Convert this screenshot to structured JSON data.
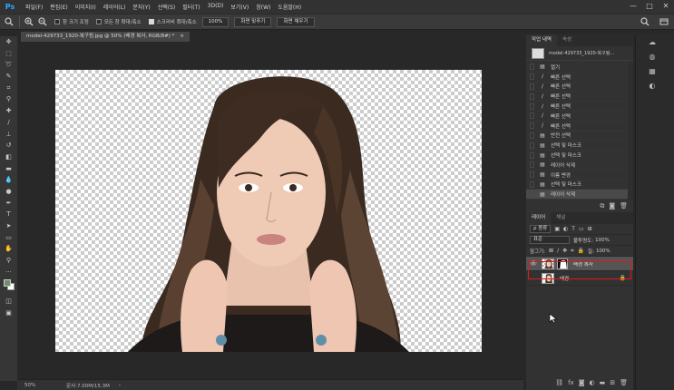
{
  "app": {
    "logo": "Ps"
  },
  "menu": [
    "파일(F)",
    "편집(E)",
    "이미지(I)",
    "레이어(L)",
    "문자(Y)",
    "선택(S)",
    "필터(T)",
    "3D(D)",
    "보기(V)",
    "창(W)",
    "도움말(H)"
  ],
  "window_controls": [
    "—",
    "□",
    "✕"
  ],
  "options": {
    "checks": [
      {
        "label": "창 크기 조정",
        "checked": false
      },
      {
        "label": "모든 창 확대/축소",
        "checked": false
      },
      {
        "label": "스크러비 확대/축소",
        "checked": true
      }
    ],
    "zoom_value": "100%",
    "fit_button": "화면 맞추기",
    "fill_button": "화면 채우기"
  },
  "document": {
    "tab_title": "model-429733_1920-복구됨.jpg @ 50% (배경 복사, RGB/8#) *",
    "tab_close": "×"
  },
  "status": {
    "zoom": "50%",
    "doc_info": "문서:7.00M/15.3M",
    "arrow": "›"
  },
  "history": {
    "tabs": [
      "작업 내역",
      "속성"
    ],
    "snapshot_label": "model-429733_1920-복구됨...",
    "items": [
      {
        "label": "열기",
        "icon": "doc-icon"
      },
      {
        "label": "빠른 선택",
        "icon": "brush-icon"
      },
      {
        "label": "빠른 선택",
        "icon": "brush-icon"
      },
      {
        "label": "빠른 선택",
        "icon": "brush-icon"
      },
      {
        "label": "빠른 선택",
        "icon": "brush-icon"
      },
      {
        "label": "빠른 선택",
        "icon": "brush-icon"
      },
      {
        "label": "빠른 선택",
        "icon": "brush-icon"
      },
      {
        "label": "반전 선택",
        "icon": "doc-icon"
      },
      {
        "label": "선택 및 마스크",
        "icon": "doc-icon"
      },
      {
        "label": "선택 및 마스크",
        "icon": "doc-icon"
      },
      {
        "label": "레이어 삭제",
        "icon": "doc-icon"
      },
      {
        "label": "이름 변경",
        "icon": "doc-icon"
      },
      {
        "label": "선택 및 마스크",
        "icon": "doc-icon"
      },
      {
        "label": "레이어 삭제",
        "icon": "doc-icon",
        "active": true
      }
    ]
  },
  "layers": {
    "tabs": [
      "레이어",
      "채널"
    ],
    "filter_kind": "ρ 종류",
    "blend_mode": "표준",
    "opacity_label": "불투명도:",
    "opacity_value": "100%",
    "lock_label": "잠그기:",
    "fill_label": "칠:",
    "fill_value": "100%",
    "items": [
      {
        "name": "배경 복사",
        "selected": true,
        "visible": true,
        "has_mask": true
      },
      {
        "name": "배경",
        "selected": false,
        "visible": false,
        "has_mask": false,
        "locked": true
      }
    ]
  },
  "colors": {
    "accent": "#31a8ff",
    "highlight": "#e01818",
    "foreground_swatch": "#6f8f6a",
    "background_swatch": "#ffffff"
  }
}
